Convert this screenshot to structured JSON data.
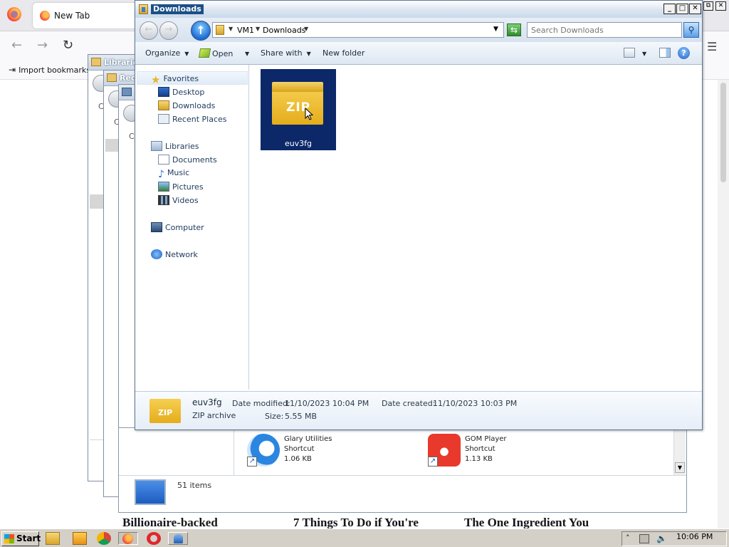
{
  "browser": {
    "tab_title": "New Tab",
    "import_bookmarks": "Import bookmarks...",
    "news": [
      "Billionaire-backed",
      "7 Things To Do if You're",
      "The One Ingredient You"
    ]
  },
  "bg_windows": {
    "libraries_title": "Librarie",
    "recent_title": "Rec",
    "letter_c": "C"
  },
  "libraries_pane": {
    "shortcuts": [
      {
        "name": "Glary Utilities",
        "type": "Shortcut",
        "size": "1.06 KB"
      },
      {
        "name": "GOM Player",
        "type": "Shortcut",
        "size": "1.13 KB"
      }
    ],
    "status": "51 items"
  },
  "window": {
    "title": "Downloads",
    "breadcrumb": [
      "VM1",
      "Downloads"
    ],
    "search_placeholder": "Search Downloads",
    "toolbar": {
      "organize": "Organize",
      "open": "Open",
      "share_with": "Share with",
      "new_folder": "New folder"
    },
    "nav": {
      "favorites": "Favorites",
      "desktop": "Desktop",
      "downloads": "Downloads",
      "recent_places": "Recent Places",
      "libraries": "Libraries",
      "documents": "Documents",
      "music": "Music",
      "pictures": "Pictures",
      "videos": "Videos",
      "computer": "Computer",
      "network": "Network"
    },
    "file": {
      "name": "euv3fg",
      "icon_text": "ZIP"
    },
    "details": {
      "name": "euv3fg",
      "type": "ZIP archive",
      "modified_label": "Date modified:",
      "modified_value": "11/10/2023 10:04 PM",
      "size_label": "Size:",
      "size_value": "5.55 MB",
      "created_label": "Date created:",
      "created_value": "11/10/2023 10:03 PM",
      "icon_text": "ZIP"
    }
  },
  "taskbar": {
    "start": "Start",
    "clock": "10:06 PM"
  }
}
